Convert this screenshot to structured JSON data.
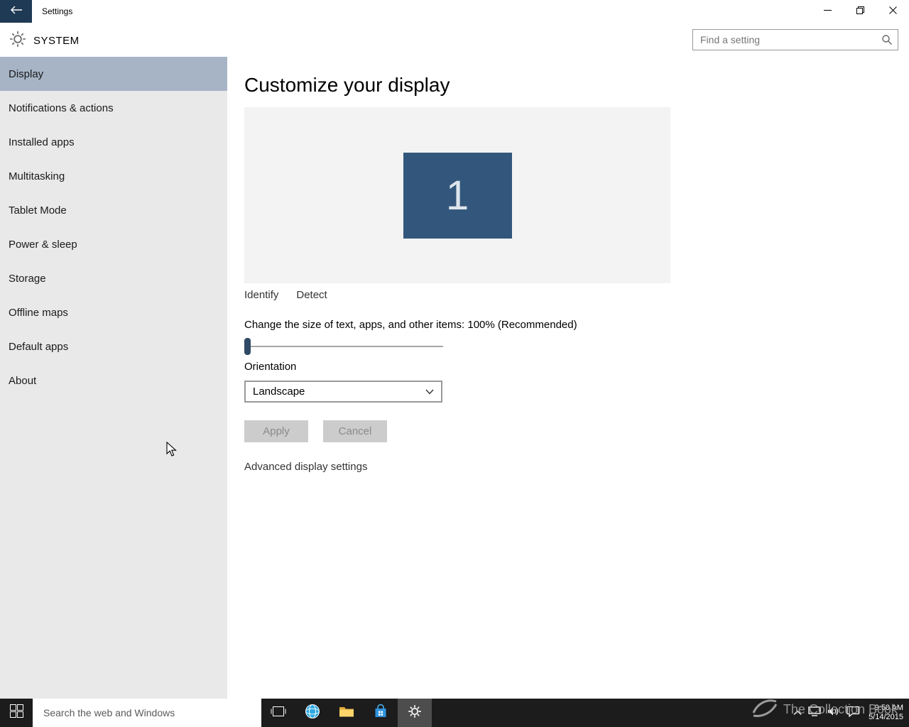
{
  "window": {
    "title": "Settings"
  },
  "header": {
    "section_title": "SYSTEM",
    "search_placeholder": "Find a setting"
  },
  "sidebar": {
    "items": [
      {
        "label": "Display",
        "selected": true
      },
      {
        "label": "Notifications & actions",
        "selected": false
      },
      {
        "label": "Installed apps",
        "selected": false
      },
      {
        "label": "Multitasking",
        "selected": false
      },
      {
        "label": "Tablet Mode",
        "selected": false
      },
      {
        "label": "Power & sleep",
        "selected": false
      },
      {
        "label": "Storage",
        "selected": false
      },
      {
        "label": "Offline maps",
        "selected": false
      },
      {
        "label": "Default apps",
        "selected": false
      },
      {
        "label": "About",
        "selected": false
      }
    ]
  },
  "main": {
    "heading": "Customize your display",
    "display_preview": {
      "monitor_number": "1"
    },
    "identify_link": "Identify",
    "detect_link": "Detect",
    "scale": {
      "label": "Change the size of text, apps, and other items: 100% (Recommended)",
      "value_percent": 100,
      "slider_position": 0
    },
    "orientation": {
      "label": "Orientation",
      "selected_option": "Landscape"
    },
    "apply_button": "Apply",
    "cancel_button": "Cancel",
    "advanced_link": "Advanced display settings"
  },
  "taskbar": {
    "search_placeholder": "Search the web and Windows",
    "clock": {
      "time": "9:50 AM",
      "date": "5/14/2015"
    }
  },
  "watermark": {
    "text": "The Collection Book"
  },
  "icons": {
    "titlebar": [
      "back-arrow",
      "minimize",
      "restore",
      "close"
    ],
    "header": [
      "settings-gear",
      "search-magnifier"
    ],
    "main": [
      "chevron-down"
    ],
    "taskbar": [
      "windows-start",
      "task-view",
      "browser-globe",
      "file-explorer-folder",
      "store-bag",
      "settings-gear",
      "chevron-up",
      "network",
      "speaker",
      "action-center"
    ]
  },
  "colors": {
    "accent_blue": "#33577c",
    "titlebar_back": "#1f3a55",
    "sidebar_selected": "#a6b4c6",
    "taskbar_bg": "#1c1c1c"
  }
}
